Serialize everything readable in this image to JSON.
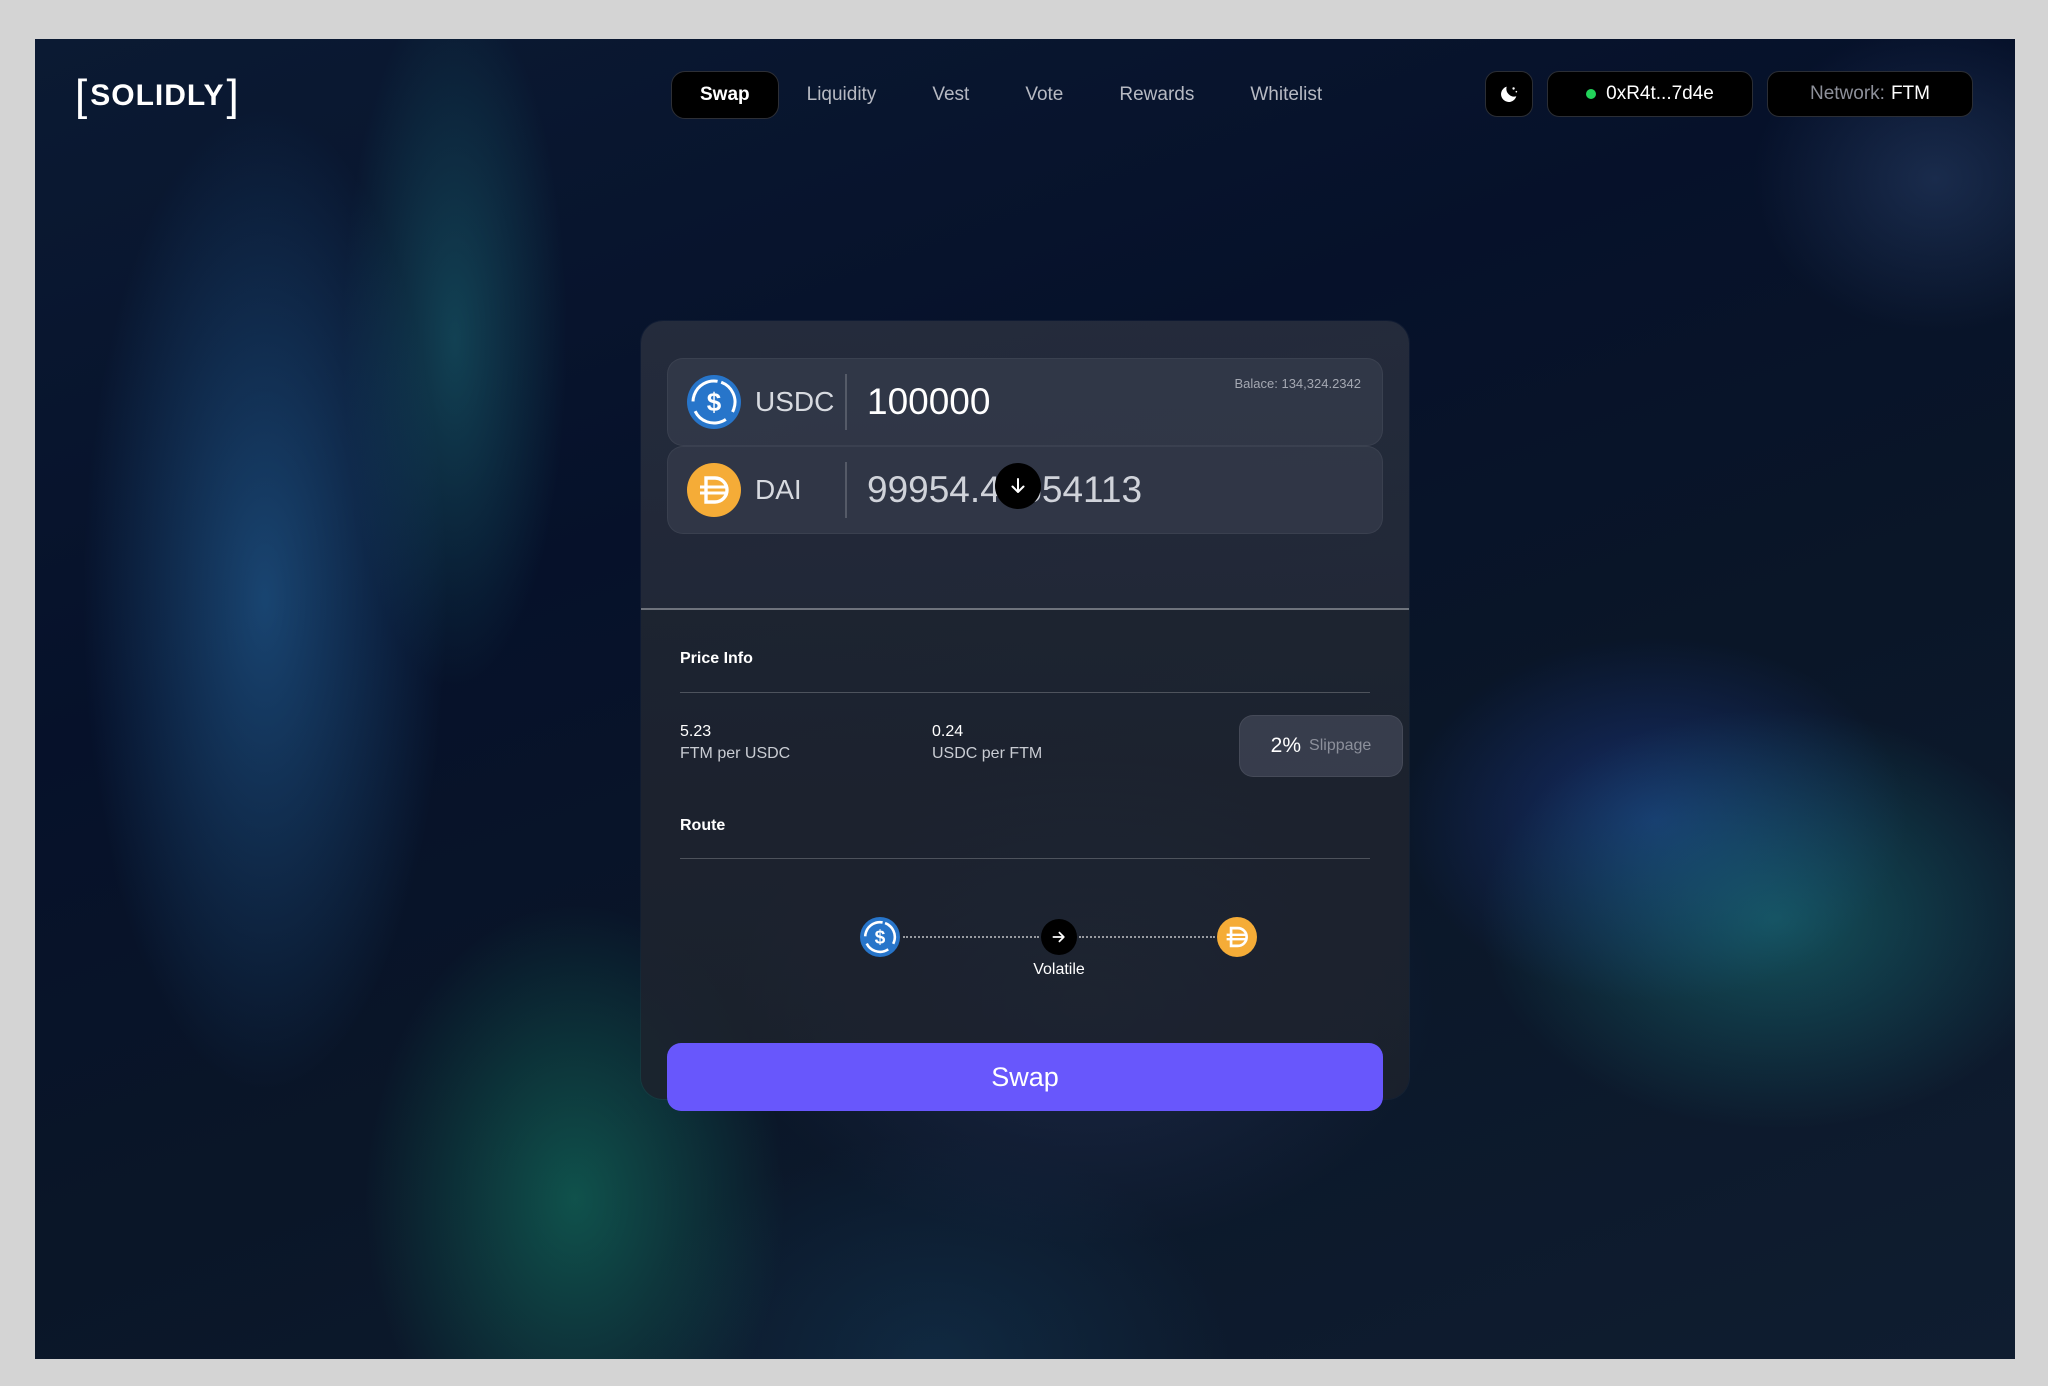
{
  "logo": {
    "text": "SOLIDLY"
  },
  "nav": {
    "items": [
      {
        "label": "Swap",
        "active": true
      },
      {
        "label": "Liquidity"
      },
      {
        "label": "Vest"
      },
      {
        "label": "Vote"
      },
      {
        "label": "Rewards"
      },
      {
        "label": "Whitelist"
      }
    ]
  },
  "header": {
    "theme_icon": "moon-icon",
    "wallet_address": "0xR4t...7d4e",
    "network_label": "Network:",
    "network_value": "FTM",
    "wallet_status_color": "#22d35a"
  },
  "swap": {
    "from": {
      "symbol": "USDC",
      "amount": "100000",
      "balance": "Balace: 134,324.2342",
      "color": "#2775ca"
    },
    "to": {
      "symbol": "DAI",
      "amount": "99954.40654113",
      "color": "#f5ac37"
    },
    "price_info": {
      "title": "Price Info",
      "rate1_value": "5.23",
      "rate1_label": "FTM per USDC",
      "rate2_value": "0.24",
      "rate2_label": "USDC per FTM",
      "slippage_value": "2%",
      "slippage_label": "Slippage"
    },
    "route": {
      "title": "Route",
      "pool_type": "Volatile"
    },
    "button_label": "Swap",
    "accent_color": "#6857fc"
  }
}
